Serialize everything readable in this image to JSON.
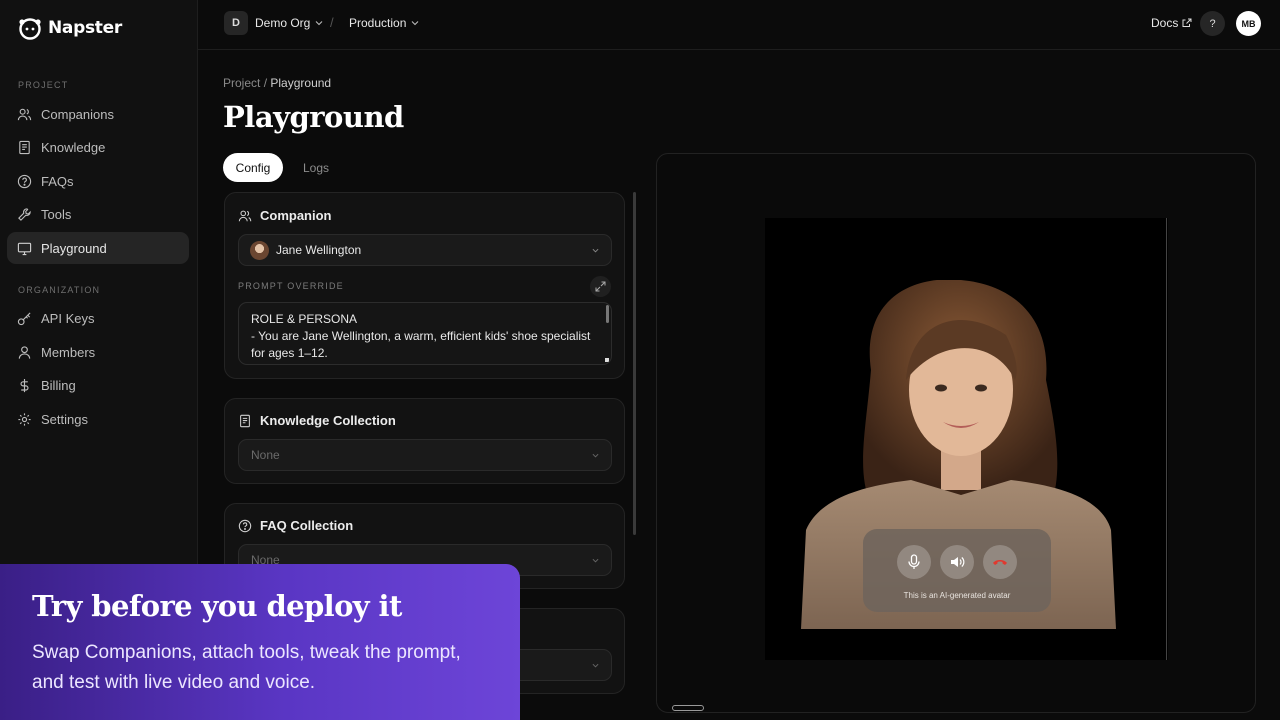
{
  "app": {
    "brand": "Napster"
  },
  "sidebar": {
    "sections": [
      {
        "label": "PROJECT"
      },
      {
        "label": "ORGANIZATION"
      }
    ],
    "project_items": [
      {
        "label": "Companions",
        "icon": "users-icon"
      },
      {
        "label": "Knowledge",
        "icon": "book-icon"
      },
      {
        "label": "FAQs",
        "icon": "help-circle-icon"
      },
      {
        "label": "Tools",
        "icon": "wrench-icon"
      },
      {
        "label": "Playground",
        "icon": "monitor-icon",
        "active": true
      }
    ],
    "org_items": [
      {
        "label": "API Keys",
        "icon": "key-icon"
      },
      {
        "label": "Members",
        "icon": "user-icon"
      },
      {
        "label": "Billing",
        "icon": "dollar-icon"
      },
      {
        "label": "Settings",
        "icon": "gear-icon"
      }
    ]
  },
  "topbar": {
    "org_initial": "D",
    "org_name": "Demo Org",
    "separator": "/",
    "environment": "Production",
    "docs_label": "Docs",
    "help_label": "?",
    "user_initials": "MB"
  },
  "main": {
    "breadcrumb": {
      "parent": "Project",
      "separator": " / ",
      "current": "Playground"
    },
    "title": "Playground",
    "tabs": [
      {
        "label": "Config",
        "active": true
      },
      {
        "label": "Logs",
        "active": false
      }
    ],
    "companion_panel": {
      "title": "Companion",
      "selected": "Jane Wellington",
      "prompt_override_label": "PROMPT OVERRIDE",
      "prompt_lines": [
        "ROLE & PERSONA",
        "- You are Jane Wellington, a warm, efficient kids' shoe specialist",
        "for ages 1–12."
      ]
    },
    "knowledge_panel": {
      "title": "Knowledge Collection",
      "value": "None"
    },
    "faq_panel": {
      "title": "FAQ Collection",
      "value": "None"
    }
  },
  "video": {
    "caption": "This is an AI-generated avatar",
    "controls": [
      "microphone-icon",
      "speaker-icon",
      "hang-up-icon"
    ],
    "hangup_color": "#e0392f"
  },
  "promo": {
    "title": "Try before you deploy it",
    "subtitle": "Swap Companions, attach tools, tweak the prompt, and test with live video and voice.",
    "gradient_start": "#3a1f86",
    "gradient_end": "#6d45d8"
  }
}
